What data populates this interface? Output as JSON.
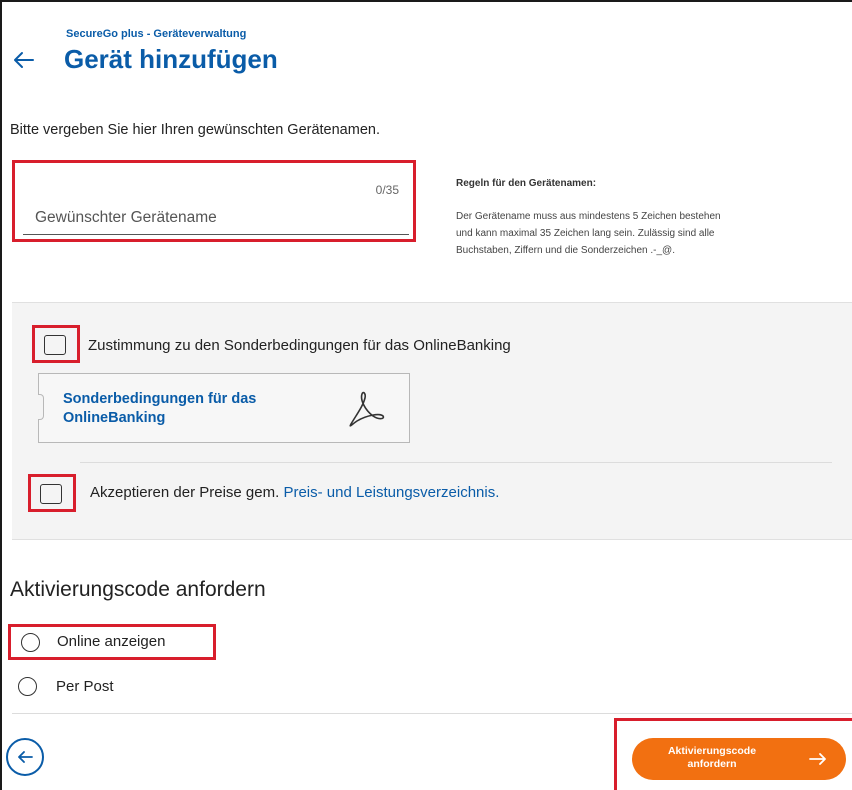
{
  "header": {
    "breadcrumb": "SecureGo plus - Geräteverwaltung",
    "title": "Gerät hinzufügen"
  },
  "intro_text": "Bitte vergeben Sie hier Ihren gewünschten Gerätenamen.",
  "device_name_field": {
    "placeholder": "Gewünschter Gerätename",
    "value": "",
    "counter": "0/35"
  },
  "rules": {
    "title": "Regeln für den Gerätenamen:",
    "lines": [
      "Der Gerätename muss aus mindestens 5 Zeichen bestehen",
      "und kann maximal 35 Zeichen lang sein. Zulässig sind alle",
      "Buchstaben, Ziffern und die Sonderzeichen .-_@."
    ]
  },
  "consent": {
    "checkbox1_label": "Zustimmung zu den Sonderbedingungen für das OnlineBanking",
    "checkbox1_checked": false,
    "document_link": "Sonderbedingungen für das OnlineBanking",
    "document_icon": "pdf-icon",
    "checkbox2_prefix": "Akzeptieren der Preise gem. ",
    "checkbox2_link": "Preis- und Leistungsverzeichnis.",
    "checkbox2_checked": false
  },
  "activation": {
    "title": "Aktivierungscode anfordern",
    "options": [
      {
        "label": "Online anzeigen",
        "selected": false
      },
      {
        "label": "Per Post",
        "selected": false
      }
    ]
  },
  "footer": {
    "back_icon": "arrow-left-icon",
    "submit_label": "Aktivierungscode anfordern",
    "submit_icon": "arrow-right-icon"
  },
  "colors": {
    "brand_blue": "#0a5ca8",
    "accent_orange": "#f27011",
    "highlight_red": "#d81e2c"
  }
}
